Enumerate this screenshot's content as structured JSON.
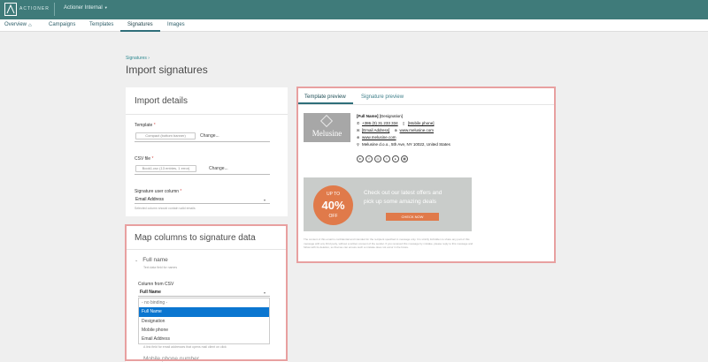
{
  "app": {
    "brand": "ACTIONER",
    "org_switch": "Actioner Internal"
  },
  "nav": {
    "items": [
      "Overview",
      "Campaigns",
      "Templates",
      "Signatures",
      "Images"
    ],
    "active": "Signatures"
  },
  "breadcrumb": "Signatures ›",
  "page_title": "Import signatures",
  "import_details": {
    "title": "Import details",
    "template_label": "Template",
    "template_file": "Compact (bottom banner)",
    "change_label": "Change...",
    "csv_label": "CSV file",
    "csv_file": "Book1.csv (13 entries, 1 error)",
    "user_column_label": "Signature user column",
    "user_column_value": "Email Address",
    "user_column_hint": "Selected column should contain valid emails"
  },
  "map_columns": {
    "title": "Map columns to signature data",
    "section": "Full name",
    "section_hint": "Text data field for names",
    "column_label": "Column from CSV",
    "column_value": "Full Name",
    "options": [
      "- no binding -",
      "Full Name",
      "Designation",
      "Mobile phone",
      "Email Address"
    ],
    "selected_option": "Full Name",
    "bottom_hint": "A link field for email addresses that opens mail client on click",
    "next_section": "Mobile phone number"
  },
  "preview": {
    "tabs": [
      "Template preview",
      "Signature preview"
    ],
    "active_tab": "Template preview",
    "logo_text": "Melusine",
    "name": "[Full Name]",
    "designation": "[Designation]",
    "phone": "+386 (0) 31 233 334",
    "mobile": "[Mobile phone]",
    "email": "[Email Address]",
    "website_a": "www.melusine.com",
    "website_b": "www.melusine.com",
    "address": "Melusine d.o.o., 5th Ave, NY 10022, United States",
    "social_icons": [
      "linkedin-icon",
      "facebook-icon",
      "instagram-icon",
      "twitter-icon",
      "youtube-icon",
      "calendar-icon"
    ],
    "banner": {
      "upto": "UP TO",
      "percent": "40%",
      "off": "OFF",
      "line1": "Check out our latest offers and",
      "line2": "pick up some amazing deals",
      "button": "CHECK NOW"
    },
    "disclaimer": "The content of this email is confidential and intended for the recipient specified in message only. It is strictly forbidden to share any part of this message with any third party, without a written consent of the sender. If you received this message by mistake, please reply to this message and follow with its deletion, so that we can ensure such a mistake does not occur in the future."
  },
  "colors": {
    "topbar": "#3f7b7a",
    "accent": "#2f6f7a",
    "highlight": "#e8a0a0",
    "banner": "#e07a4a",
    "selected": "#0b76d0"
  }
}
